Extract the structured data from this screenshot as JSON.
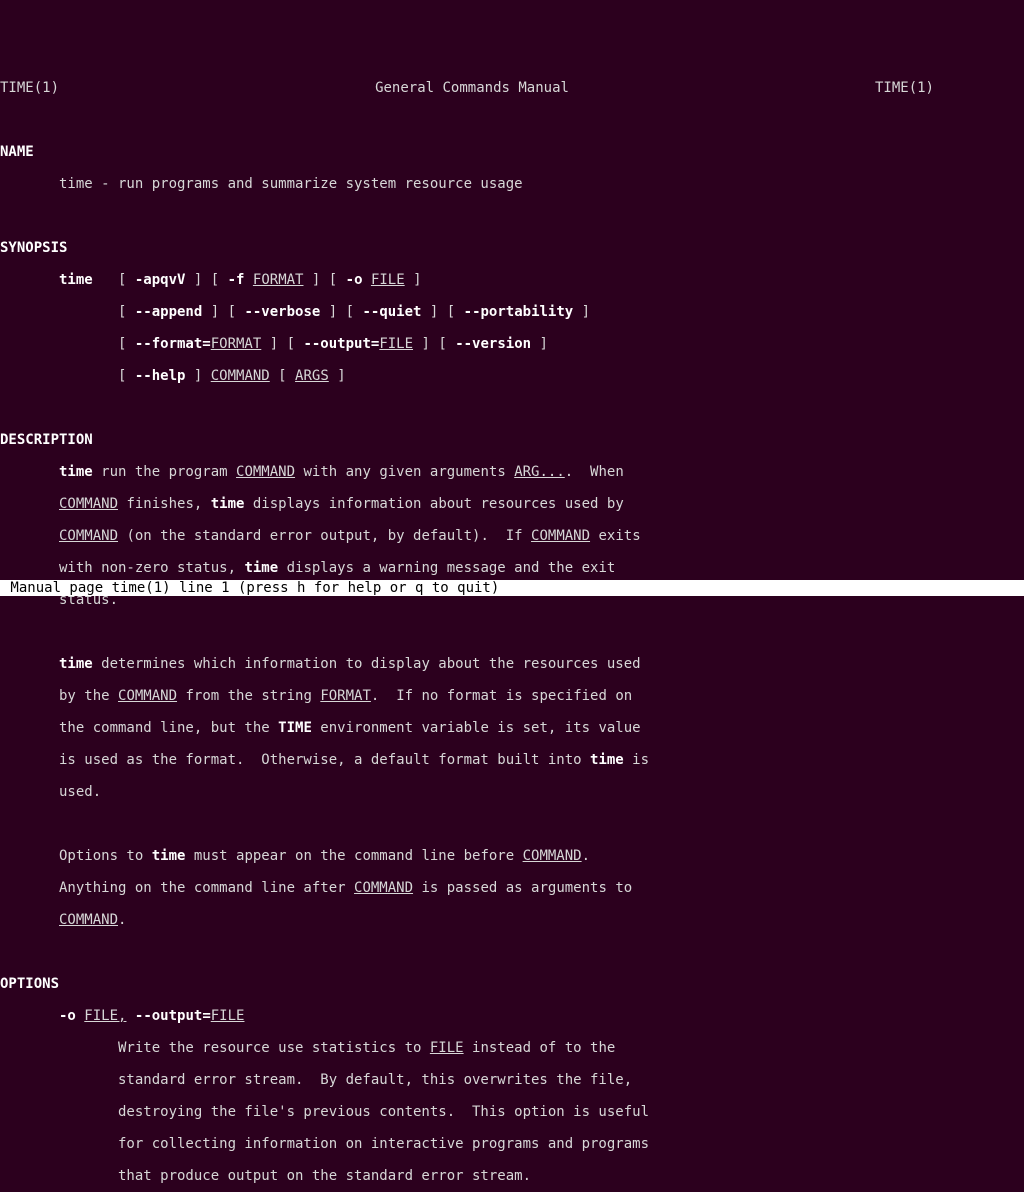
{
  "header": {
    "left": "TIME(1)",
    "center": "General Commands Manual",
    "right": "TIME(1)"
  },
  "sections": {
    "name": "NAME",
    "synopsis": "SYNOPSIS",
    "description": "DESCRIPTION",
    "options": "OPTIONS"
  },
  "name_line": "time - run programs and summarize system resource usage",
  "syn": {
    "cmd": "time",
    "flags1": "-apqvV",
    "f": "-f",
    "format_u": "FORMAT",
    "o": "-o",
    "file_u": "FILE",
    "append": "--append",
    "verbose": "--verbose",
    "quiet": "--quiet",
    "portability": "--portability",
    "format_long": "--format=",
    "output_long": "--output=",
    "version": "--version",
    "help": "--help",
    "command_u": "COMMAND",
    "args_u": "ARGS"
  },
  "desc": {
    "p1_a": " run the program ",
    "p1_b": " with any given arguments ",
    "arg_u": "ARG...",
    "p1_c": ".  When",
    "p1_d": " finishes, ",
    "p1_e": " displays information about resources used by",
    "p1_f": " (on the standard error output, by default).  If ",
    "p1_g": " exits",
    "p1_h": "with non-zero status, ",
    "p1_i": " displays a warning message and the exit",
    "p1_j": "status.",
    "p2_a": " determines which information to display about the resources used",
    "p2_b": "by the ",
    "p2_c": " from the string ",
    "p2_d": ".  If no format is specified on",
    "p2_e": "the command line, but the ",
    "time_env": "TIME",
    "p2_f": " environment variable is set, its value",
    "p2_g": "is used as the format.  Otherwise, a default format built into ",
    "p2_h": " is",
    "p2_i": "used.",
    "p3_a": "Options to ",
    "p3_b": " must appear on the command line before ",
    "p3_c": ".",
    "p3_d": "Anything on the command line after ",
    "p3_e": " is passed as arguments to"
  },
  "opt": {
    "o_flag": "-o ",
    "file_comma": "FILE,",
    "sp": " ",
    "output_eq": "--output=",
    "file_u": "FILE",
    "l1": "Write the resource use statistics to ",
    "l1b": " instead of to the",
    "l2": "standard error stream.  By default, this overwrites the file,",
    "l3": "destroying the file's previous contents.  This option is useful",
    "l4": "for collecting information on interactive programs and programs",
    "l5": "that produce output on the standard error stream."
  },
  "status": " Manual page time(1) line 1 (press h for help or q to quit)"
}
